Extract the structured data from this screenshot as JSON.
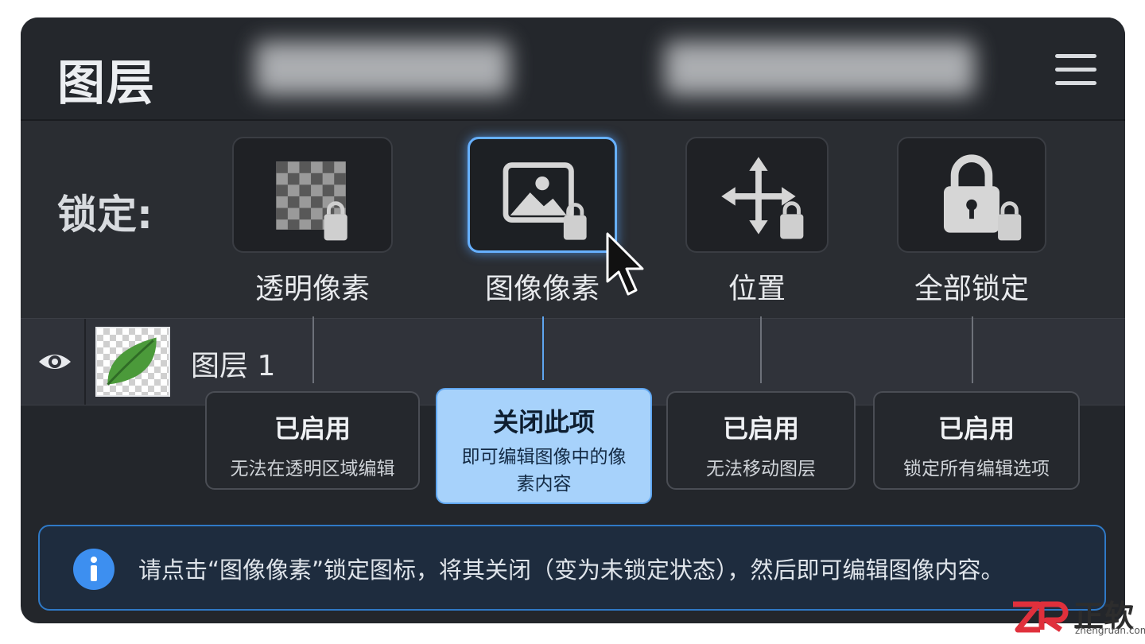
{
  "panel": {
    "title": "图层"
  },
  "lock": {
    "label": "锁定:",
    "buttons": [
      {
        "id": "transparent",
        "label": "透明像素",
        "icon": "checkerboard-lock-icon",
        "active": false
      },
      {
        "id": "image",
        "label": "图像像素",
        "icon": "image-lock-icon",
        "active": true
      },
      {
        "id": "position",
        "label": "位置",
        "icon": "move-lock-icon",
        "active": false
      },
      {
        "id": "all",
        "label": "全部锁定",
        "icon": "padlock-icon",
        "active": false
      }
    ]
  },
  "layer": {
    "name": "图层 1",
    "thumbnail": "leaf"
  },
  "tooltips": [
    {
      "title": "已启用",
      "desc": "无法在透明区域编辑"
    },
    {
      "title": "关闭此项",
      "desc": "即可编辑图像中的像素内容",
      "highlight": true
    },
    {
      "title": "已启用",
      "desc": "无法移动图层"
    },
    {
      "title": "已启用",
      "desc": "锁定所有编辑选项"
    }
  ],
  "info": {
    "text": "请点击“图像像素”锁定图标，将其关闭（变为未锁定状态），然后即可编辑图像内容。"
  },
  "watermark": {
    "brand": "正软",
    "url": "zhengruan.com"
  },
  "colors": {
    "accent": "#66b0ff",
    "panel_bg": "#23262b",
    "info_icon": "#3d8ff0"
  }
}
